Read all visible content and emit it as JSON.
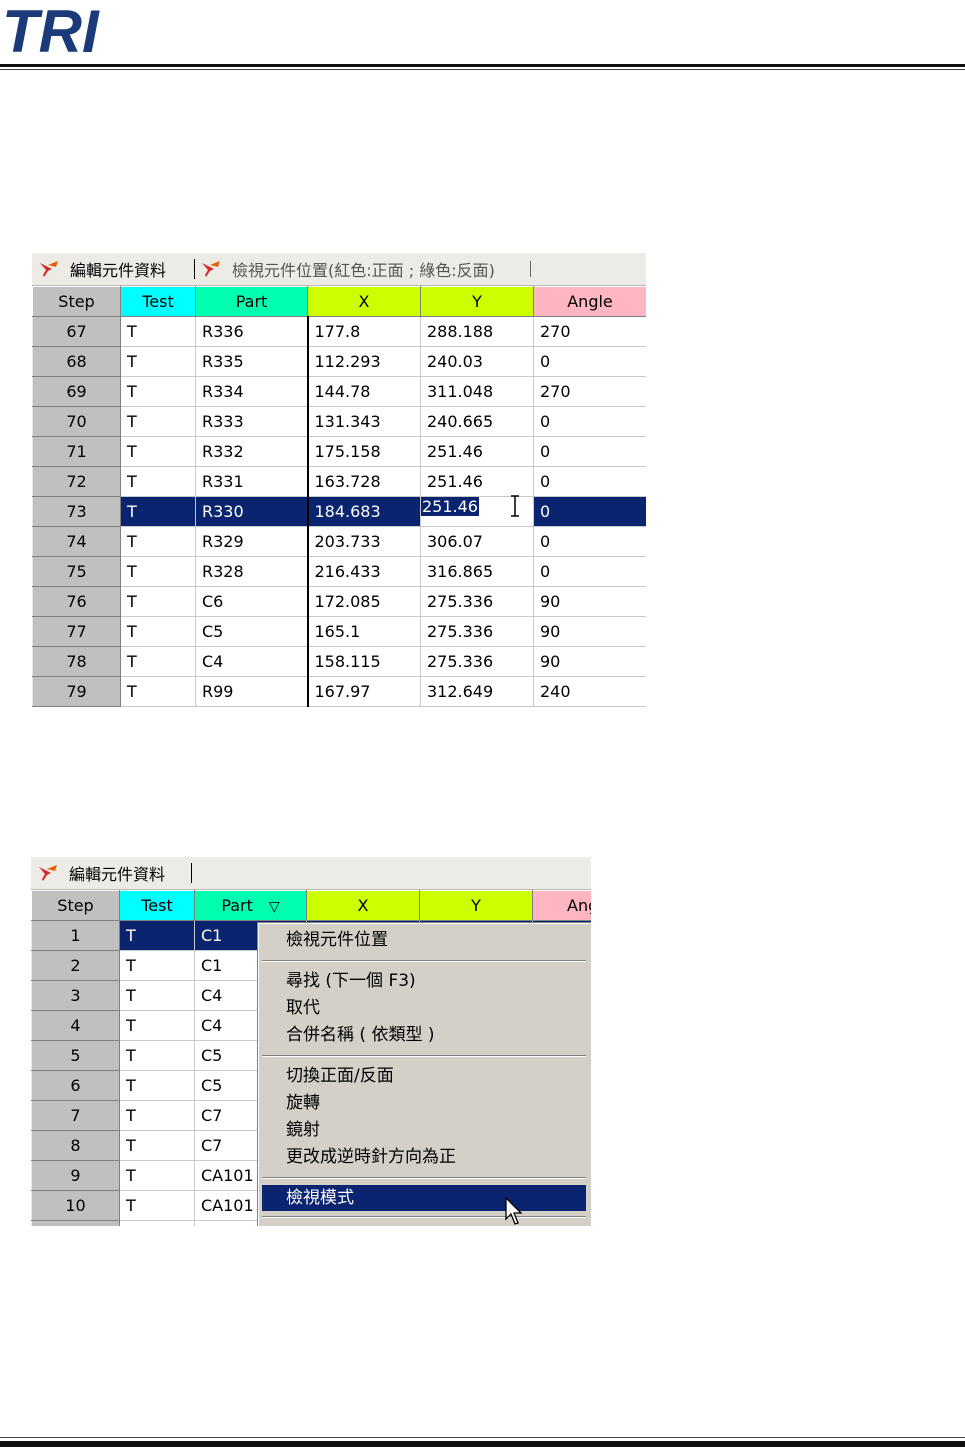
{
  "logo": {
    "text": "TRI"
  },
  "figure1": {
    "tabs": [
      {
        "label": "編輯元件資料"
      },
      {
        "label": "檢視元件位置(紅色:正面 ; 綠色:反面)"
      }
    ],
    "columns": [
      {
        "label": "Step",
        "color": "#c0c0c0"
      },
      {
        "label": "Test",
        "color": "#00ffff"
      },
      {
        "label": "Part",
        "color": "#00ffb0"
      },
      {
        "label": "X",
        "color": "#ccff00"
      },
      {
        "label": "Y",
        "color": "#ccff00"
      },
      {
        "label": "Angle",
        "color": "#ffb6c1"
      }
    ],
    "rows": [
      {
        "step": "67",
        "test": "T",
        "part": "R336",
        "x": "177.8",
        "y": "288.188",
        "angle": "270"
      },
      {
        "step": "68",
        "test": "T",
        "part": "R335",
        "x": "112.293",
        "y": "240.03",
        "angle": "0"
      },
      {
        "step": "69",
        "test": "T",
        "part": "R334",
        "x": "144.78",
        "y": "311.048",
        "angle": "270"
      },
      {
        "step": "70",
        "test": "T",
        "part": "R333",
        "x": "131.343",
        "y": "240.665",
        "angle": "0"
      },
      {
        "step": "71",
        "test": "T",
        "part": "R332",
        "x": "175.158",
        "y": "251.46",
        "angle": "0"
      },
      {
        "step": "72",
        "test": "T",
        "part": "R331",
        "x": "163.728",
        "y": "251.46",
        "angle": "0"
      },
      {
        "step": "73",
        "test": "T",
        "part": "R330",
        "x": "184.683",
        "y": "251.46",
        "angle": "0",
        "selected": true,
        "editing_cell": "y"
      },
      {
        "step": "74",
        "test": "T",
        "part": "R329",
        "x": "203.733",
        "y": "306.07",
        "angle": "0"
      },
      {
        "step": "75",
        "test": "T",
        "part": "R328",
        "x": "216.433",
        "y": "316.865",
        "angle": "0"
      },
      {
        "step": "76",
        "test": "T",
        "part": "C6",
        "x": "172.085",
        "y": "275.336",
        "angle": "90"
      },
      {
        "step": "77",
        "test": "T",
        "part": "C5",
        "x": "165.1",
        "y": "275.336",
        "angle": "90"
      },
      {
        "step": "78",
        "test": "T",
        "part": "C4",
        "x": "158.115",
        "y": "275.336",
        "angle": "90"
      },
      {
        "step": "79",
        "test": "T",
        "part": "R99",
        "x": "167.97",
        "y": "312.649",
        "angle": "240"
      }
    ]
  },
  "figure2": {
    "tabs": [
      {
        "label": "編輯元件資料"
      }
    ],
    "columns": [
      {
        "label": "Step",
        "color": "#c0c0c0"
      },
      {
        "label": "Test",
        "color": "#00ffff"
      },
      {
        "label": "Part",
        "color": "#00ffb0",
        "sort_icon": "▽"
      },
      {
        "label": "X",
        "color": "#ccff00"
      },
      {
        "label": "Y",
        "color": "#ccff00"
      },
      {
        "label": "Angle",
        "color": "#ffb6c1"
      }
    ],
    "rows": [
      {
        "step": "1",
        "test": "T",
        "part": "C1",
        "selected": true
      },
      {
        "step": "2",
        "test": "T",
        "part": "C1"
      },
      {
        "step": "3",
        "test": "T",
        "part": "C4"
      },
      {
        "step": "4",
        "test": "T",
        "part": "C4"
      },
      {
        "step": "5",
        "test": "T",
        "part": "C5"
      },
      {
        "step": "6",
        "test": "T",
        "part": "C5"
      },
      {
        "step": "7",
        "test": "T",
        "part": "C7"
      },
      {
        "step": "8",
        "test": "T",
        "part": "C7"
      },
      {
        "step": "9",
        "test": "T",
        "part": "CA101"
      },
      {
        "step": "10",
        "test": "T",
        "part": "CA101"
      }
    ],
    "context_menu": {
      "items": [
        {
          "label": "檢視元件位置"
        },
        {
          "separator": true
        },
        {
          "label": "尋找 (下一個  F3)"
        },
        {
          "label": "取代"
        },
        {
          "label": "合併名稱 ( 依類型 )"
        },
        {
          "separator": true
        },
        {
          "label": "切換正面/反面"
        },
        {
          "label": "旋轉"
        },
        {
          "label": "鏡射"
        },
        {
          "label": "更改成逆時針方向為正"
        },
        {
          "separator": true
        },
        {
          "label": "檢視模式",
          "highlighted": true
        }
      ]
    }
  }
}
